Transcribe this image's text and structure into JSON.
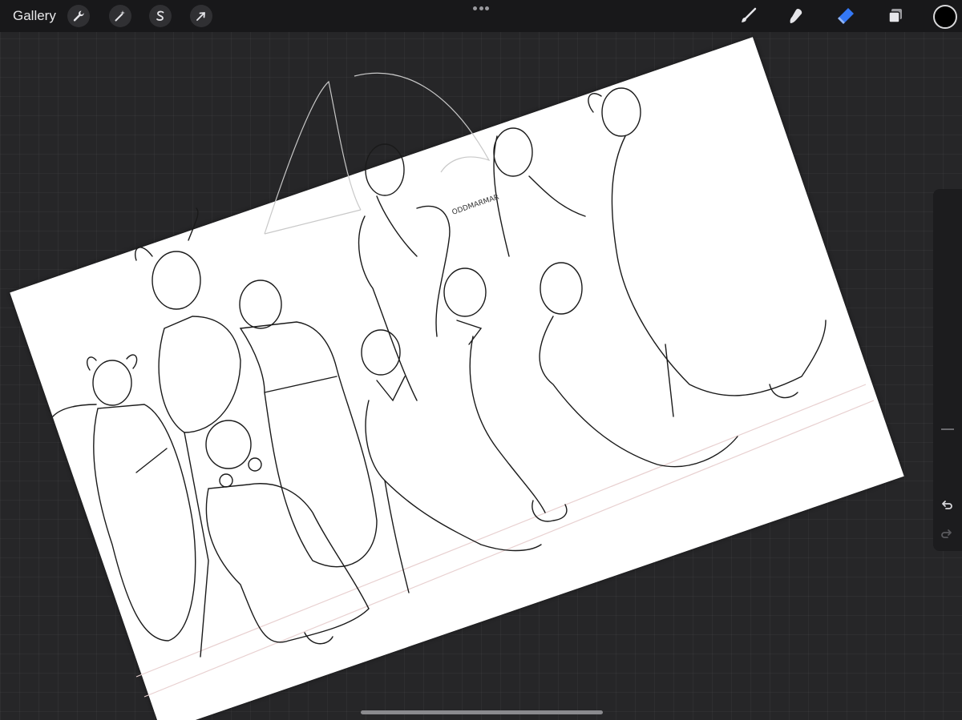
{
  "topbar": {
    "gallery_label": "Gallery",
    "left_tools": [
      {
        "name": "wrench-icon"
      },
      {
        "name": "magic-wand-icon"
      },
      {
        "name": "selection-s-icon"
      },
      {
        "name": "transform-arrow-icon"
      }
    ],
    "right_tools": [
      {
        "name": "brush-icon",
        "active": false
      },
      {
        "name": "smudge-icon",
        "active": false
      },
      {
        "name": "eraser-icon",
        "active": true
      },
      {
        "name": "layers-icon",
        "active": false
      }
    ],
    "current_color": "#000000",
    "accent_color": "#3478f6"
  },
  "sidebar": {
    "brush_size_level": 0.45,
    "opacity_level": 0.5,
    "undo_icon": "undo-icon",
    "redo_icon": "redo-icon"
  },
  "canvas": {
    "signature": "ODDMARMAR"
  }
}
